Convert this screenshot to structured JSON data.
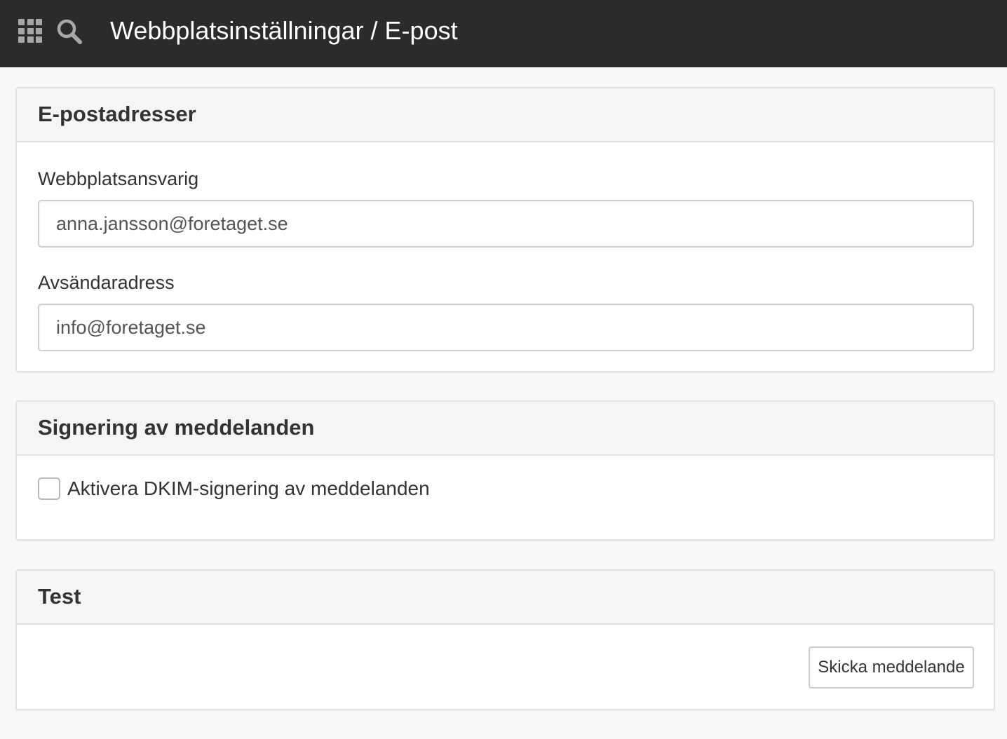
{
  "header": {
    "title": "Webbplatsinställningar / E-post",
    "apps_icon": "apps-grid-icon",
    "search_icon": "search-icon",
    "background_color": "#2b2b2b"
  },
  "email_addresses": {
    "heading": "E-postadresser",
    "site_admin": {
      "label": "Webbplatsansvarig",
      "value": "anna.jansson@foretaget.se"
    },
    "sender_address": {
      "label": "Avsändaradress",
      "value": "info@foretaget.se"
    }
  },
  "signing": {
    "heading": "Signering av meddelanden",
    "dkim_checkbox": {
      "label": "Aktivera DKIM-signering av meddelanden",
      "checked": false
    }
  },
  "test": {
    "heading": "Test",
    "send_button_label": "Skicka meddelande"
  }
}
